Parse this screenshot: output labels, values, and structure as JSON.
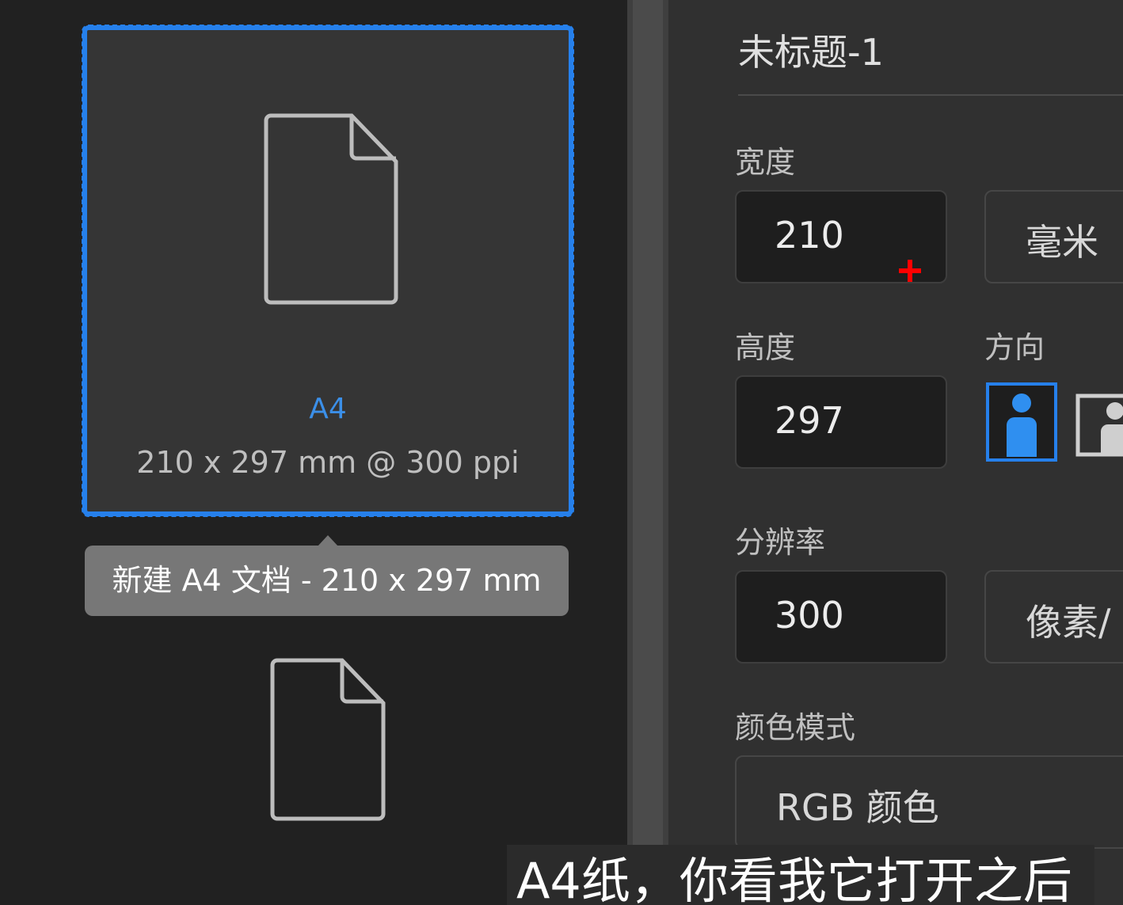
{
  "preset": {
    "name": "A4",
    "details": "210 x 297 mm @ 300 ppi",
    "tooltip": "新建 A4 文档 - 210 x 297 mm"
  },
  "document": {
    "title": "未标题-1",
    "width_label": "宽度",
    "width_value": "210",
    "unit_value": "毫米",
    "height_label": "高度",
    "height_value": "297",
    "orientation_label": "方向",
    "orientation_selected": "portrait",
    "resolution_label": "分辨率",
    "resolution_value": "300",
    "resolution_unit": "像素/",
    "color_mode_label": "颜色模式",
    "color_mode_value": "RGB 颜色"
  },
  "subtitle": "A4纸，你看我它打开之后",
  "colors": {
    "accent": "#2680eb",
    "background": "#212121",
    "panel": "#303030",
    "cursor": "#ff0000"
  }
}
